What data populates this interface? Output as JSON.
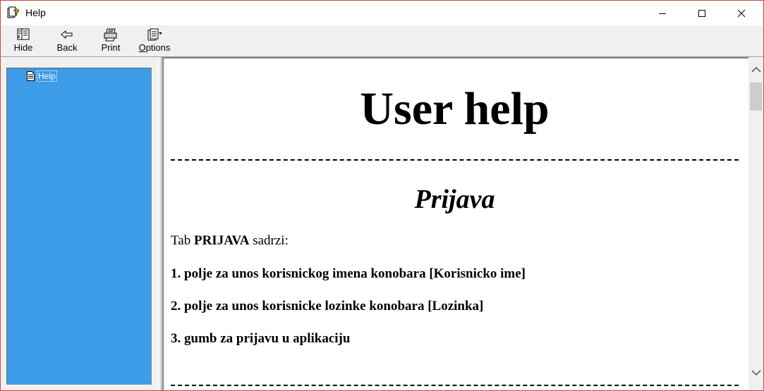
{
  "window": {
    "title": "Help",
    "accent": "#c9483c"
  },
  "toolbar": {
    "hide_label": "Hide",
    "back_label": "Back",
    "print_label": "Print",
    "options_label_underlined": "O",
    "options_label_rest": "ptions"
  },
  "nav": {
    "background": "#3c9ce8",
    "items": [
      {
        "label": "Help",
        "icon": "page-icon"
      }
    ]
  },
  "document": {
    "title": "User help",
    "section_title": "Prijava",
    "intro_prefix": "Tab ",
    "intro_bold": "PRIJAVA",
    "intro_suffix": " sadrzi:",
    "items": [
      "1. polje za unos korisnickog imena konobara [Korisnicko ime]",
      "2. polje za unos korisnicke lozinke konobara [Lozinka]",
      "3. gumb za prijavu u aplikaciju"
    ]
  }
}
